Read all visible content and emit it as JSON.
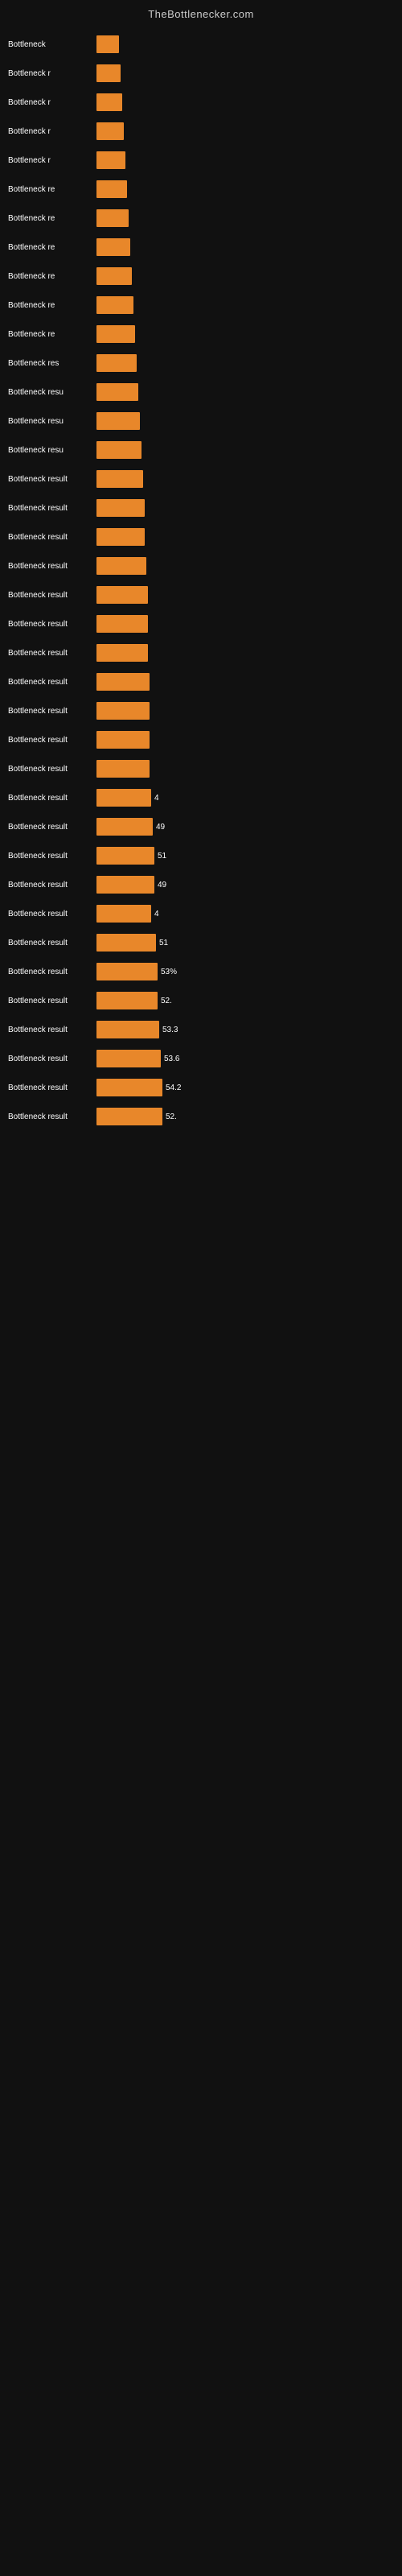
{
  "header": {
    "title": "TheBottlenecker.com"
  },
  "rows": [
    {
      "label": "Bottleneck",
      "value": null,
      "barWidth": 28
    },
    {
      "label": "Bottleneck r",
      "value": null,
      "barWidth": 30
    },
    {
      "label": "Bottleneck r",
      "value": null,
      "barWidth": 32
    },
    {
      "label": "Bottleneck r",
      "value": null,
      "barWidth": 34
    },
    {
      "label": "Bottleneck r",
      "value": null,
      "barWidth": 36
    },
    {
      "label": "Bottleneck re",
      "value": null,
      "barWidth": 38
    },
    {
      "label": "Bottleneck re",
      "value": null,
      "barWidth": 40
    },
    {
      "label": "Bottleneck re",
      "value": null,
      "barWidth": 42
    },
    {
      "label": "Bottleneck re",
      "value": null,
      "barWidth": 44
    },
    {
      "label": "Bottleneck re",
      "value": null,
      "barWidth": 46
    },
    {
      "label": "Bottleneck re",
      "value": null,
      "barWidth": 48
    },
    {
      "label": "Bottleneck res",
      "value": null,
      "barWidth": 50
    },
    {
      "label": "Bottleneck resu",
      "value": null,
      "barWidth": 52
    },
    {
      "label": "Bottleneck resu",
      "value": null,
      "barWidth": 54
    },
    {
      "label": "Bottleneck resu",
      "value": null,
      "barWidth": 56
    },
    {
      "label": "Bottleneck result",
      "value": null,
      "barWidth": 58
    },
    {
      "label": "Bottleneck result",
      "value": null,
      "barWidth": 60
    },
    {
      "label": "Bottleneck result",
      "value": null,
      "barWidth": 60
    },
    {
      "label": "Bottleneck result",
      "value": null,
      "barWidth": 62
    },
    {
      "label": "Bottleneck result",
      "value": null,
      "barWidth": 64
    },
    {
      "label": "Bottleneck result",
      "value": null,
      "barWidth": 64
    },
    {
      "label": "Bottleneck result",
      "value": null,
      "barWidth": 64
    },
    {
      "label": "Bottleneck result",
      "value": null,
      "barWidth": 66
    },
    {
      "label": "Bottleneck result",
      "value": null,
      "barWidth": 66
    },
    {
      "label": "Bottleneck result",
      "value": null,
      "barWidth": 66
    },
    {
      "label": "Bottleneck result",
      "value": null,
      "barWidth": 66
    },
    {
      "label": "Bottleneck result",
      "value": "4",
      "barWidth": 68
    },
    {
      "label": "Bottleneck result",
      "value": "49",
      "barWidth": 70
    },
    {
      "label": "Bottleneck result",
      "value": "51",
      "barWidth": 72
    },
    {
      "label": "Bottleneck result",
      "value": "49",
      "barWidth": 72
    },
    {
      "label": "Bottleneck result",
      "value": "4",
      "barWidth": 68
    },
    {
      "label": "Bottleneck result",
      "value": "51",
      "barWidth": 74
    },
    {
      "label": "Bottleneck result",
      "value": "53%",
      "barWidth": 76
    },
    {
      "label": "Bottleneck result",
      "value": "52.",
      "barWidth": 76
    },
    {
      "label": "Bottleneck result",
      "value": "53.3",
      "barWidth": 78
    },
    {
      "label": "Bottleneck result",
      "value": "53.6",
      "barWidth": 80
    },
    {
      "label": "Bottleneck result",
      "value": "54.2",
      "barWidth": 82
    },
    {
      "label": "Bottleneck result",
      "value": "52.",
      "barWidth": 82
    }
  ]
}
